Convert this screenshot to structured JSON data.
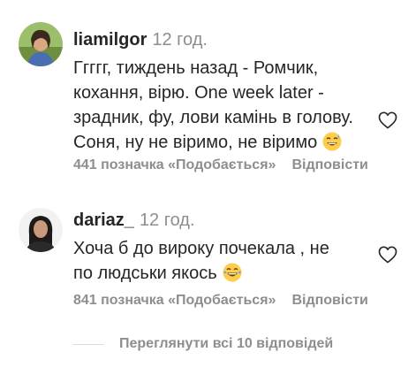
{
  "comments": [
    {
      "username": "liamilgor",
      "time": "12 год.",
      "lines": [
        "Ггггг, тиждень назад - Ромчик,",
        "кохання, вірю. One week later -",
        "зрадник, фу, лови камінь в голову.",
        "Соня, ну не віримо, не віримо"
      ],
      "emoji": "grinning-sweat-emoji",
      "likes": "441 позначка «Подобається»",
      "reply": "Відповісти",
      "avatar": "user-photo-avatar"
    },
    {
      "username": "dariaz_",
      "time": "12 год.",
      "lines": [
        "Хоча б до вироку почекала , не",
        "по людськи якось"
      ],
      "emoji": "tears-of-joy-emoji",
      "likes": "841 позначка «Подобається»",
      "reply": "Відповісти",
      "avatar": "user-photo-avatar"
    }
  ],
  "view_replies": "Переглянути всі 10 відповідей",
  "colors": {
    "text": "#262626",
    "secondary": "#8e8e8e",
    "divider": "#dbdbdb",
    "emoji": "#ffcc4d"
  }
}
